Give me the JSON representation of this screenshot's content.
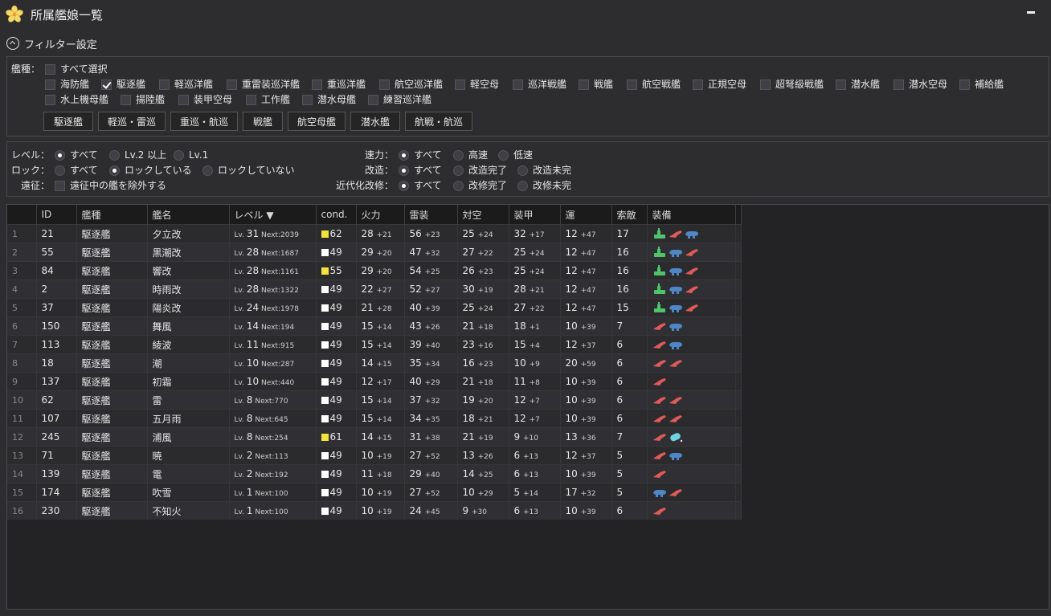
{
  "window": {
    "title": "所属艦娘一覧"
  },
  "filter": {
    "header": "フィルター設定",
    "ship_type_label": "艦種：",
    "select_all": {
      "label": "すべて選択",
      "checked": false
    },
    "ship_types": [
      {
        "label": "海防艦",
        "checked": false
      },
      {
        "label": "駆逐艦",
        "checked": true
      },
      {
        "label": "軽巡洋艦",
        "checked": false
      },
      {
        "label": "重雷装巡洋艦",
        "checked": false
      },
      {
        "label": "重巡洋艦",
        "checked": false
      },
      {
        "label": "航空巡洋艦",
        "checked": false
      },
      {
        "label": "軽空母",
        "checked": false
      },
      {
        "label": "巡洋戦艦",
        "checked": false
      },
      {
        "label": "戦艦",
        "checked": false
      },
      {
        "label": "航空戦艦",
        "checked": false
      },
      {
        "label": "正規空母",
        "checked": false
      },
      {
        "label": "超弩級戦艦",
        "checked": false
      },
      {
        "label": "潜水艦",
        "checked": false
      },
      {
        "label": "潜水空母",
        "checked": false
      },
      {
        "label": "補給艦",
        "checked": false
      },
      {
        "label": "水上機母艦",
        "checked": false
      },
      {
        "label": "揚陸艦",
        "checked": false
      },
      {
        "label": "装甲空母",
        "checked": false
      },
      {
        "label": "工作艦",
        "checked": false
      },
      {
        "label": "潜水母艦",
        "checked": false
      },
      {
        "label": "練習巡洋艦",
        "checked": false
      }
    ],
    "quick_buttons": [
      "駆逐艦",
      "軽巡・雷巡",
      "重巡・航巡",
      "戦艦",
      "航空母艦",
      "潜水艦",
      "航戦・航巡"
    ],
    "level": {
      "label": "レベル：",
      "options": [
        "すべて",
        "Lv.2 以上",
        "Lv.1"
      ],
      "selected": 0
    },
    "lock": {
      "label": "ロック：",
      "options": [
        "すべて",
        "ロックしている",
        "ロックしていない"
      ],
      "selected": 1
    },
    "expedition": {
      "label": "遠征：",
      "checkbox": "遠征中の艦を除外する",
      "checked": false
    },
    "speed": {
      "label": "速力：",
      "options": [
        "すべて",
        "高速",
        "低速"
      ],
      "selected": 0
    },
    "remodel": {
      "label": "改造：",
      "options": [
        "すべて",
        "改造完了",
        "改造未完"
      ],
      "selected": 0
    },
    "modernize": {
      "label": "近代化改修：",
      "options": [
        "すべて",
        "改修完了",
        "改修未完"
      ],
      "selected": 0
    }
  },
  "table": {
    "columns": [
      "",
      "ID",
      "艦種",
      "艦名",
      "レベル ▼",
      "cond.",
      "火力",
      "雷装",
      "対空",
      "装甲",
      "運",
      "索敵",
      "装備"
    ],
    "colors": {
      "cond_normal": "#ffffff",
      "cond_high": "#f2e43a",
      "gun": "#e05a5a",
      "torpedo": "#4f86c6",
      "radar": "#4fc26a",
      "drum": "#6fd3e0"
    },
    "rows": [
      {
        "no": "1",
        "id": "21",
        "type": "駆逐艦",
        "name": "夕立改",
        "lv": "31",
        "next": "2039",
        "cond": "62",
        "cond_high": true,
        "fp": "28",
        "fp_b": "+21",
        "tp": "56",
        "tp_b": "+23",
        "aa": "25",
        "aa_b": "+24",
        "ar": "32",
        "ar_b": "+17",
        "luck": "12",
        "luck_b": "+47",
        "los": "17",
        "equip": [
          "radar",
          "gun",
          "torpedo"
        ]
      },
      {
        "no": "2",
        "id": "55",
        "type": "駆逐艦",
        "name": "黒潮改",
        "lv": "28",
        "next": "1687",
        "cond": "49",
        "cond_high": false,
        "fp": "29",
        "fp_b": "+20",
        "tp": "47",
        "tp_b": "+32",
        "aa": "27",
        "aa_b": "+22",
        "ar": "25",
        "ar_b": "+24",
        "luck": "12",
        "luck_b": "+47",
        "los": "16",
        "equip": [
          "radar",
          "torpedo",
          "gun"
        ]
      },
      {
        "no": "3",
        "id": "84",
        "type": "駆逐艦",
        "name": "響改",
        "lv": "28",
        "next": "1161",
        "cond": "55",
        "cond_high": true,
        "fp": "29",
        "fp_b": "+20",
        "tp": "54",
        "tp_b": "+25",
        "aa": "26",
        "aa_b": "+23",
        "ar": "25",
        "ar_b": "+24",
        "luck": "12",
        "luck_b": "+47",
        "los": "16",
        "equip": [
          "radar",
          "torpedo",
          "gun"
        ]
      },
      {
        "no": "4",
        "id": "2",
        "type": "駆逐艦",
        "name": "時雨改",
        "lv": "28",
        "next": "1322",
        "cond": "49",
        "cond_high": false,
        "fp": "22",
        "fp_b": "+27",
        "tp": "52",
        "tp_b": "+27",
        "aa": "30",
        "aa_b": "+19",
        "ar": "28",
        "ar_b": "+21",
        "luck": "12",
        "luck_b": "+47",
        "los": "16",
        "equip": [
          "radar",
          "torpedo",
          "gun"
        ]
      },
      {
        "no": "5",
        "id": "37",
        "type": "駆逐艦",
        "name": "陽炎改",
        "lv": "24",
        "next": "1978",
        "cond": "49",
        "cond_high": false,
        "fp": "21",
        "fp_b": "+28",
        "tp": "40",
        "tp_b": "+39",
        "aa": "25",
        "aa_b": "+24",
        "ar": "27",
        "ar_b": "+22",
        "luck": "12",
        "luck_b": "+47",
        "los": "15",
        "equip": [
          "radar",
          "torpedo",
          "gun"
        ]
      },
      {
        "no": "6",
        "id": "150",
        "type": "駆逐艦",
        "name": "舞風",
        "lv": "14",
        "next": "194",
        "cond": "49",
        "cond_high": false,
        "fp": "15",
        "fp_b": "+14",
        "tp": "43",
        "tp_b": "+26",
        "aa": "21",
        "aa_b": "+18",
        "ar": "18",
        "ar_b": "+1",
        "luck": "10",
        "luck_b": "+39",
        "los": "7",
        "equip": [
          "gun",
          "torpedo"
        ]
      },
      {
        "no": "7",
        "id": "113",
        "type": "駆逐艦",
        "name": "綾波",
        "lv": "11",
        "next": "915",
        "cond": "49",
        "cond_high": false,
        "fp": "15",
        "fp_b": "+14",
        "tp": "39",
        "tp_b": "+40",
        "aa": "23",
        "aa_b": "+16",
        "ar": "15",
        "ar_b": "+4",
        "luck": "12",
        "luck_b": "+37",
        "los": "6",
        "equip": [
          "gun",
          "torpedo"
        ]
      },
      {
        "no": "8",
        "id": "18",
        "type": "駆逐艦",
        "name": "潮",
        "lv": "10",
        "next": "287",
        "cond": "49",
        "cond_high": false,
        "fp": "14",
        "fp_b": "+15",
        "tp": "35",
        "tp_b": "+34",
        "aa": "16",
        "aa_b": "+23",
        "ar": "10",
        "ar_b": "+9",
        "luck": "20",
        "luck_b": "+59",
        "los": "6",
        "equip": [
          "gun",
          "gun"
        ]
      },
      {
        "no": "9",
        "id": "137",
        "type": "駆逐艦",
        "name": "初霜",
        "lv": "10",
        "next": "440",
        "cond": "49",
        "cond_high": false,
        "fp": "12",
        "fp_b": "+17",
        "tp": "40",
        "tp_b": "+29",
        "aa": "21",
        "aa_b": "+18",
        "ar": "11",
        "ar_b": "+8",
        "luck": "10",
        "luck_b": "+39",
        "los": "6",
        "equip": [
          "gun"
        ]
      },
      {
        "no": "10",
        "id": "62",
        "type": "駆逐艦",
        "name": "雷",
        "lv": "8",
        "next": "770",
        "cond": "49",
        "cond_high": false,
        "fp": "15",
        "fp_b": "+14",
        "tp": "37",
        "tp_b": "+32",
        "aa": "19",
        "aa_b": "+20",
        "ar": "12",
        "ar_b": "+7",
        "luck": "10",
        "luck_b": "+39",
        "los": "6",
        "equip": [
          "gun",
          "gun"
        ]
      },
      {
        "no": "11",
        "id": "107",
        "type": "駆逐艦",
        "name": "五月雨",
        "lv": "8",
        "next": "645",
        "cond": "49",
        "cond_high": false,
        "fp": "15",
        "fp_b": "+14",
        "tp": "34",
        "tp_b": "+35",
        "aa": "18",
        "aa_b": "+21",
        "ar": "12",
        "ar_b": "+7",
        "luck": "10",
        "luck_b": "+39",
        "los": "6",
        "equip": [
          "gun",
          "gun"
        ]
      },
      {
        "no": "12",
        "id": "245",
        "type": "駆逐艦",
        "name": "浦風",
        "lv": "8",
        "next": "254",
        "cond": "61",
        "cond_high": true,
        "fp": "14",
        "fp_b": "+15",
        "tp": "31",
        "tp_b": "+38",
        "aa": "21",
        "aa_b": "+19",
        "ar": "9",
        "ar_b": "+10",
        "luck": "13",
        "luck_b": "+36",
        "los": "7",
        "equip": [
          "gun",
          "drum"
        ]
      },
      {
        "no": "13",
        "id": "71",
        "type": "駆逐艦",
        "name": "暁",
        "lv": "2",
        "next": "113",
        "cond": "49",
        "cond_high": false,
        "fp": "10",
        "fp_b": "+19",
        "tp": "27",
        "tp_b": "+52",
        "aa": "13",
        "aa_b": "+26",
        "ar": "6",
        "ar_b": "+13",
        "luck": "12",
        "luck_b": "+37",
        "los": "5",
        "equip": [
          "gun",
          "torpedo"
        ]
      },
      {
        "no": "14",
        "id": "139",
        "type": "駆逐艦",
        "name": "電",
        "lv": "2",
        "next": "192",
        "cond": "49",
        "cond_high": false,
        "fp": "11",
        "fp_b": "+18",
        "tp": "29",
        "tp_b": "+40",
        "aa": "14",
        "aa_b": "+25",
        "ar": "6",
        "ar_b": "+13",
        "luck": "10",
        "luck_b": "+39",
        "los": "5",
        "equip": [
          "gun"
        ]
      },
      {
        "no": "15",
        "id": "174",
        "type": "駆逐艦",
        "name": "吹雪",
        "lv": "1",
        "next": "100",
        "cond": "49",
        "cond_high": false,
        "fp": "10",
        "fp_b": "+19",
        "tp": "27",
        "tp_b": "+52",
        "aa": "10",
        "aa_b": "+29",
        "ar": "5",
        "ar_b": "+14",
        "luck": "17",
        "luck_b": "+32",
        "los": "5",
        "equip": [
          "torpedo",
          "gun"
        ]
      },
      {
        "no": "16",
        "id": "230",
        "type": "駆逐艦",
        "name": "不知火",
        "lv": "1",
        "next": "100",
        "cond": "49",
        "cond_high": false,
        "fp": "10",
        "fp_b": "+19",
        "tp": "24",
        "tp_b": "+45",
        "aa": "9",
        "aa_b": "+30",
        "ar": "6",
        "ar_b": "+13",
        "luck": "10",
        "luck_b": "+39",
        "los": "6",
        "equip": [
          "gun"
        ]
      }
    ]
  }
}
